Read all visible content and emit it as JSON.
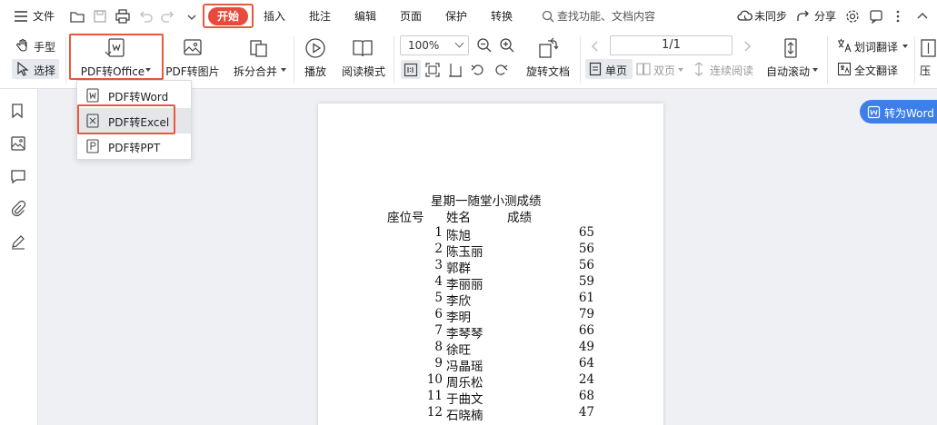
{
  "menubar": {
    "file": "文件",
    "tabs": [
      "开始",
      "插入",
      "批注",
      "编辑",
      "页面",
      "保护",
      "转换"
    ],
    "search_placeholder": "查找功能、文档内容",
    "unsynced": "未同步",
    "share": "分享"
  },
  "ribbon": {
    "hand": "手型",
    "select": "选择",
    "pdf_to_office": "PDF转Office",
    "pdf_to_image": "PDF转图片",
    "split_merge": "拆分合并",
    "play": "播放",
    "read_mode": "阅读模式",
    "zoom_value": "100%",
    "rotate_doc": "旋转文档",
    "page_indicator": "1/1",
    "single_page": "单页",
    "double_page": "双页",
    "continuous": "连续阅读",
    "auto_scroll": "自动滚动",
    "word_translate": "划词翻译",
    "full_translate": "全文翻译",
    "compress": "压"
  },
  "dropdown": {
    "items": [
      "PDF转Word",
      "PDF转Excel",
      "PDF转PPT"
    ]
  },
  "to_word": "转为Word",
  "document": {
    "title": "星期一随堂小测成绩",
    "headers": [
      "座位号",
      "姓名",
      "成绩"
    ],
    "rows": [
      {
        "n": "1",
        "name": "陈旭",
        "score": "65"
      },
      {
        "n": "2",
        "name": "陈玉丽",
        "score": "56"
      },
      {
        "n": "3",
        "name": "郭群",
        "score": "56"
      },
      {
        "n": "4",
        "name": "李丽丽",
        "score": "59"
      },
      {
        "n": "5",
        "name": "李欣",
        "score": "61"
      },
      {
        "n": "6",
        "name": "李明",
        "score": "79"
      },
      {
        "n": "7",
        "name": "李琴琴",
        "score": "66"
      },
      {
        "n": "8",
        "name": "徐旺",
        "score": "49"
      },
      {
        "n": "9",
        "name": "冯晶瑶",
        "score": "64"
      },
      {
        "n": "10",
        "name": "周乐松",
        "score": "24"
      },
      {
        "n": "11",
        "name": "于曲文",
        "score": "68"
      },
      {
        "n": "12",
        "name": "石晓楠",
        "score": "47"
      }
    ]
  },
  "colors": {
    "accent_red": "#e84b3c",
    "highlight_frame": "#e8593c",
    "to_word_blue": "#3d7fe8"
  }
}
